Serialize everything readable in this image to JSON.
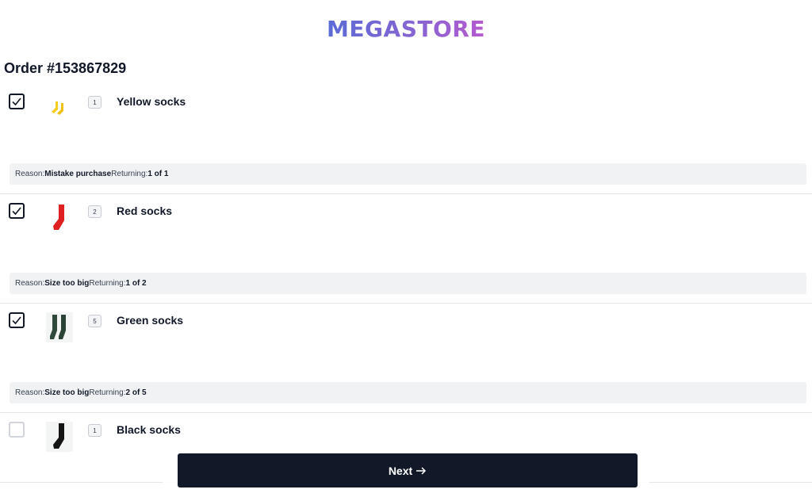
{
  "brand": {
    "logo_text": "MEGASTORE"
  },
  "order": {
    "title": "Order #153867829"
  },
  "items": [
    {
      "checked": true,
      "qty": "1",
      "name": "Yellow socks",
      "reason_label": "Reason:",
      "reason_value": "Mistake purchase",
      "returning_label": "Returning:",
      "returning_value": "1 of 1",
      "color": "#f5cd1f",
      "icon": "yellow-socks-image"
    },
    {
      "checked": true,
      "qty": "2",
      "name": "Red socks",
      "reason_label": "Reason:",
      "reason_value": "Size too big",
      "returning_label": "Returning:",
      "returning_value": "1 of 2",
      "color": "#e02020",
      "icon": "red-sock-image"
    },
    {
      "checked": true,
      "qty": "5",
      "name": "Green socks",
      "reason_label": "Reason:",
      "reason_value": "Size too big",
      "returning_label": "Returning:",
      "returning_value": "2 of 5",
      "color": "#2f4a3a",
      "icon": "green-socks-image"
    },
    {
      "checked": false,
      "qty": "1",
      "name": "Black socks",
      "color": "#141414",
      "icon": "black-sock-image"
    }
  ],
  "footer": {
    "next_label": "Next",
    "next_icon": "arrow-right-icon"
  }
}
